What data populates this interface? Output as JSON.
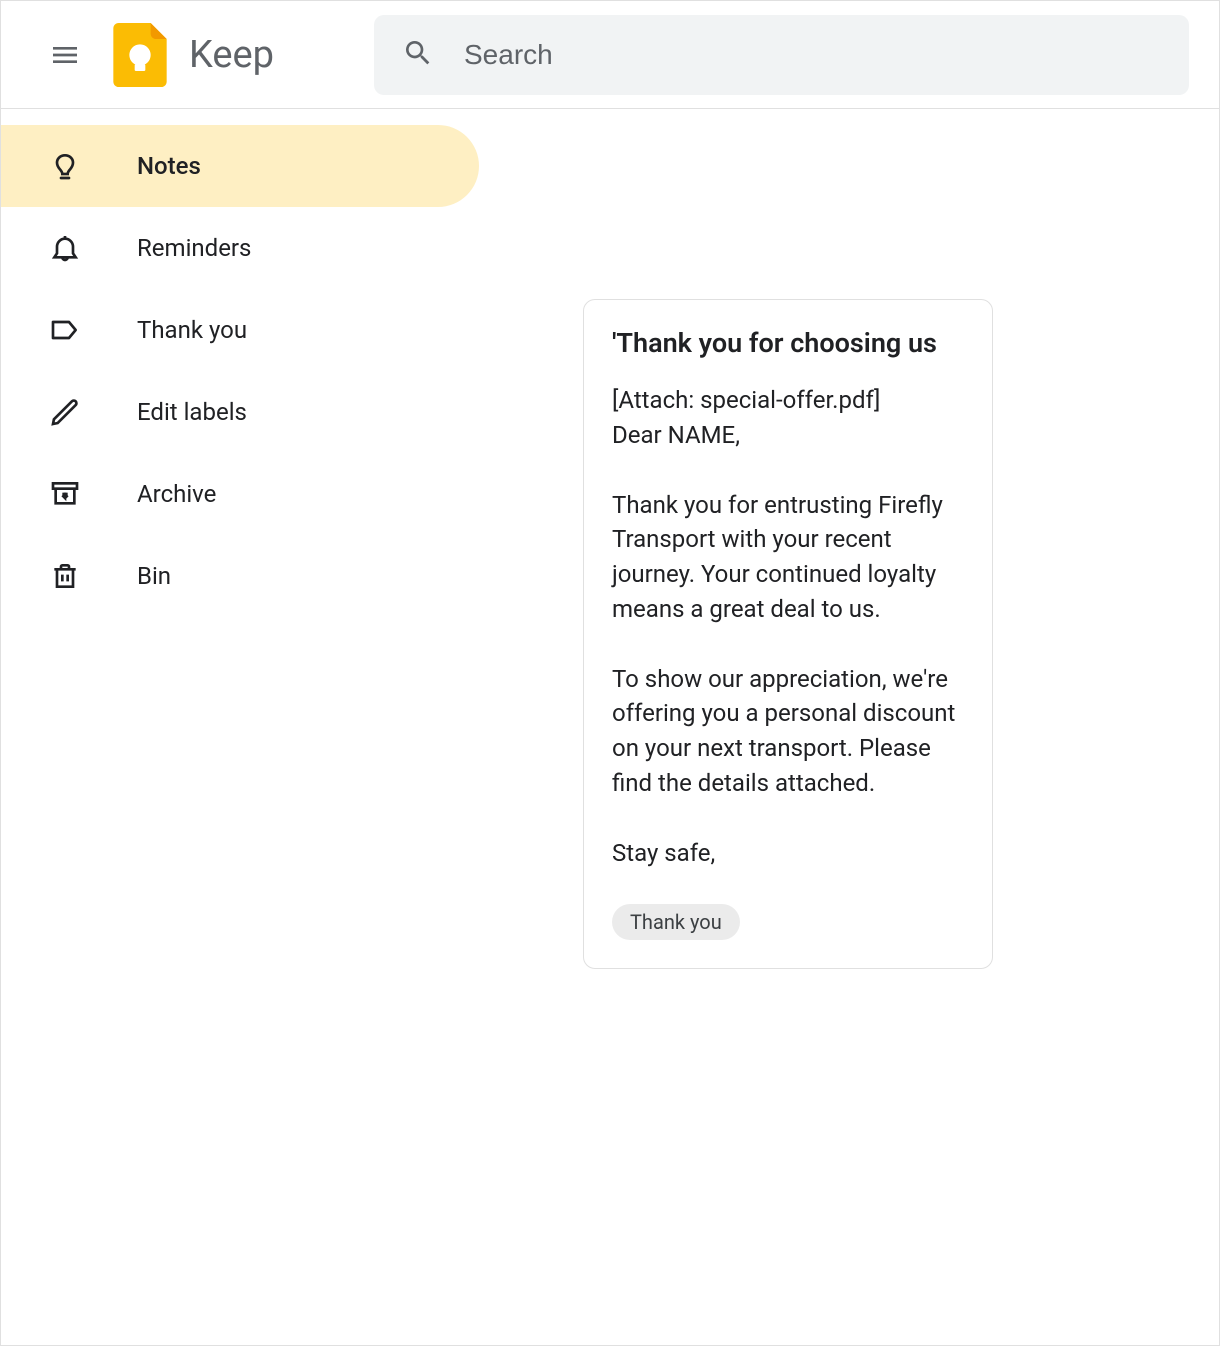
{
  "header": {
    "app_name": "Keep",
    "search_placeholder": "Search"
  },
  "sidebar": {
    "items": [
      {
        "label": "Notes",
        "icon": "lightbulb-icon",
        "active": true
      },
      {
        "label": "Reminders",
        "icon": "bell-icon",
        "active": false
      },
      {
        "label": "Thank you",
        "icon": "label-icon",
        "active": false
      },
      {
        "label": "Edit labels",
        "icon": "pencil-icon",
        "active": false
      },
      {
        "label": "Archive",
        "icon": "archive-icon",
        "active": false
      },
      {
        "label": "Bin",
        "icon": "trash-icon",
        "active": false
      }
    ]
  },
  "note": {
    "title": "'Thank you for choosing us",
    "body": "[Attach: special-offer.pdf]\nDear NAME,\n\nThank you for entrusting Firefly Transport with your recent journey. Your continued loyalty means a great deal to us.\n\nTo show our appreciation, we're offering you a personal discount on your next transport. Please find the details attached.\n\nStay safe,",
    "labels": [
      "Thank you"
    ]
  }
}
